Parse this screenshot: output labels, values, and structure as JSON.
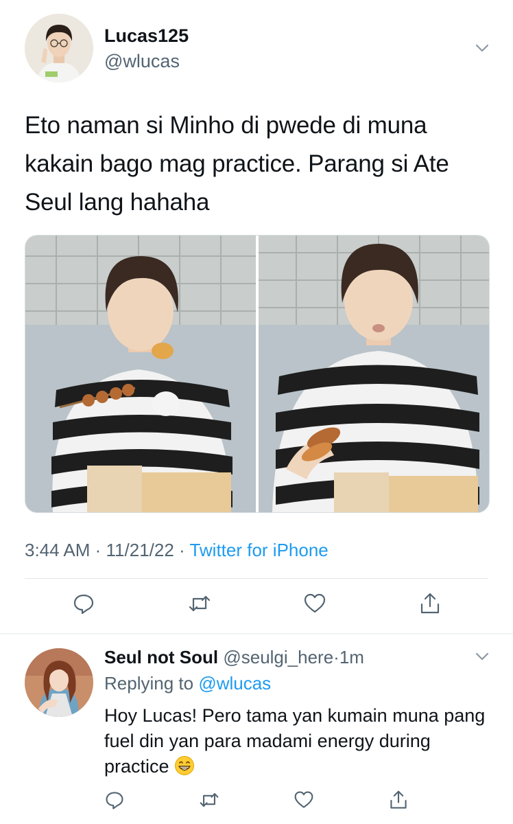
{
  "main_tweet": {
    "display_name": "Lucas125",
    "handle": "@wlucas",
    "text": "Eto naman si Minho di pwede di muna kakain bago mag practice. Parang si Ate Seul lang hahaha",
    "time": "3:44 AM",
    "date": "11/21/22",
    "separator": " · ",
    "source": "Twitter for iPhone",
    "media_count": 2
  },
  "reply_tweet": {
    "display_name": "Seul not Soul",
    "handle": "@seulgi_here",
    "dot": "·",
    "time_ago": "1m",
    "replying_to_label": "Replying to",
    "replying_to_handle": "@wlucas",
    "text": "Hoy Lucas! Pero tama yan kumain muna pang fuel din yan para madami energy during practice"
  },
  "icons": {
    "reply": "reply-icon",
    "retweet": "retweet-icon",
    "like": "heart-icon",
    "share": "share-icon",
    "menu": "chevron-down-icon"
  },
  "colors": {
    "text": "#0f1419",
    "secondary": "#536471",
    "link": "#1d9bf0",
    "divider": "#e1e6ea"
  }
}
